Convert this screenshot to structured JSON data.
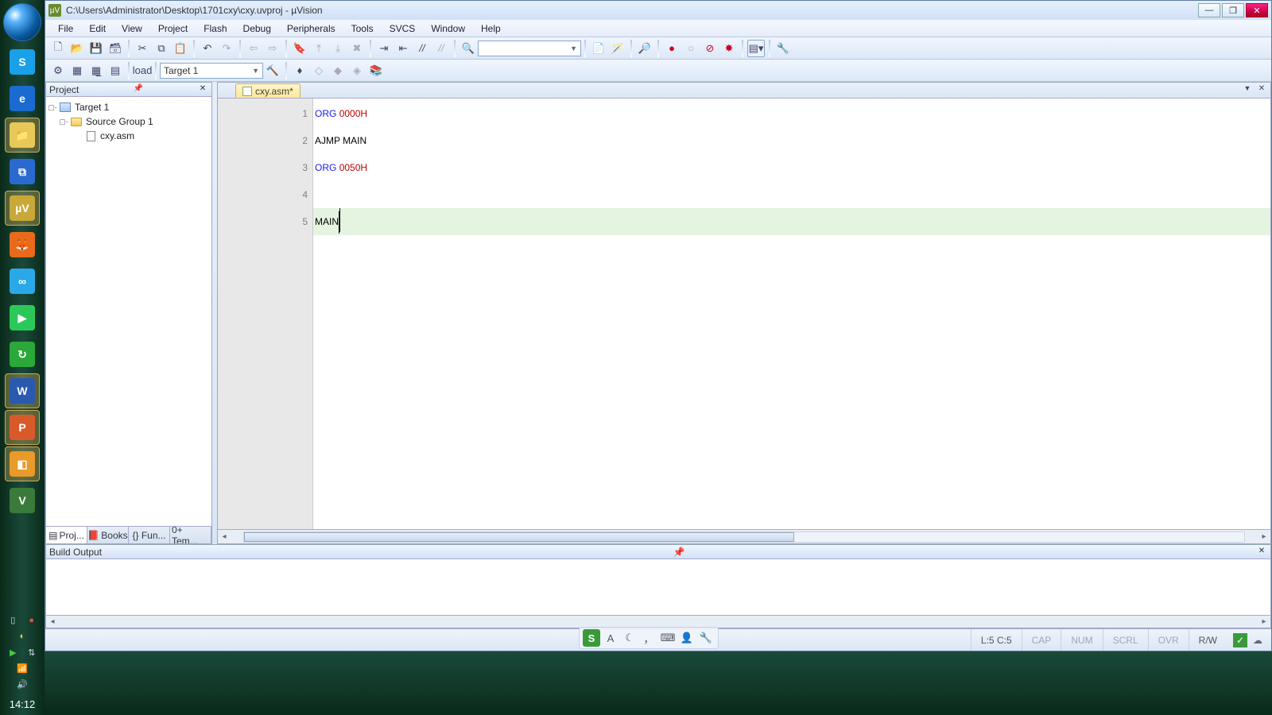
{
  "title_path": "C:\\Users\\Administrator\\Desktop\\1701cxy\\cxy.uvproj - µVision",
  "menus": [
    "File",
    "Edit",
    "View",
    "Project",
    "Flash",
    "Debug",
    "Peripherals",
    "Tools",
    "SVCS",
    "Window",
    "Help"
  ],
  "toolbar1": {
    "find_value": "",
    "find_placeholder": ""
  },
  "toolbar2": {
    "target_value": "Target 1"
  },
  "project": {
    "panel_title": "Project",
    "tree": {
      "target": "Target 1",
      "group": "Source Group 1",
      "file": "cxy.asm"
    },
    "tabs": [
      "Proj...",
      "Books",
      "{} Fun...",
      "0+ Tem..."
    ]
  },
  "editor": {
    "tab_label": "cxy.asm*",
    "lines": [
      {
        "n": "1",
        "tokens": [
          [
            "kw",
            "ORG"
          ],
          [
            "sp",
            " "
          ],
          [
            "num",
            "0000H"
          ]
        ]
      },
      {
        "n": "2",
        "tokens": [
          [
            "txt",
            "AJMP MAIN"
          ]
        ]
      },
      {
        "n": "3",
        "tokens": [
          [
            "kw",
            "ORG"
          ],
          [
            "sp",
            " "
          ],
          [
            "num",
            "0050H"
          ]
        ]
      },
      {
        "n": "4",
        "tokens": []
      },
      {
        "n": "5",
        "tokens": [
          [
            "txt",
            "MAIN"
          ]
        ],
        "current": true
      }
    ]
  },
  "build": {
    "panel_title": "Build Output"
  },
  "status": {
    "cursor": "L:5 C:5",
    "flags": [
      "CAP",
      "NUM",
      "SCRL",
      "OVR",
      "R/W"
    ],
    "ime": "S"
  },
  "taskbar": {
    "clock": "14:12",
    "icons": [
      {
        "name": "skype",
        "glyph": "S",
        "bg": "#1aa0e8"
      },
      {
        "name": "ie",
        "glyph": "e",
        "bg": "#1a6ad0"
      },
      {
        "name": "explorer",
        "glyph": "📁",
        "bg": "#e8c858",
        "active": true
      },
      {
        "name": "vscode",
        "glyph": "⧉",
        "bg": "#2a6ad0"
      },
      {
        "name": "uvision",
        "glyph": "µV",
        "bg": "#c8a838",
        "active": true
      },
      {
        "name": "firefox",
        "glyph": "🦊",
        "bg": "#e86a1a"
      },
      {
        "name": "baidu",
        "glyph": "∞",
        "bg": "#2aa8e8"
      },
      {
        "name": "media",
        "glyph": "▶",
        "bg": "#2ac858"
      },
      {
        "name": "sync",
        "glyph": "↻",
        "bg": "#2aa838"
      },
      {
        "name": "word",
        "glyph": "W",
        "bg": "#2a5ab0",
        "active": true
      },
      {
        "name": "ppt",
        "glyph": "P",
        "bg": "#d85a2a",
        "active": true
      },
      {
        "name": "app1",
        "glyph": "◧",
        "bg": "#e89a2a",
        "active": true
      },
      {
        "name": "vs",
        "glyph": "V",
        "bg": "#3a7a3a"
      }
    ]
  }
}
